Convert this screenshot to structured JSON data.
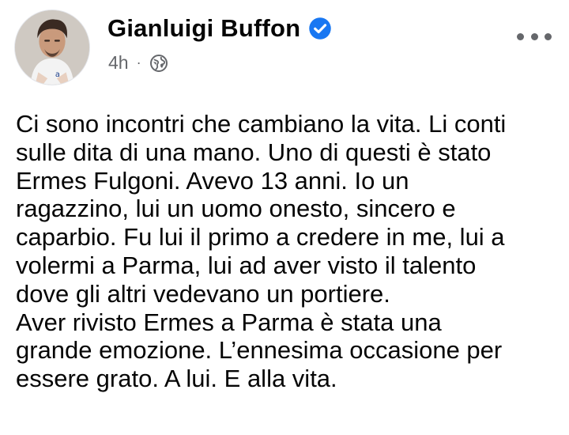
{
  "post": {
    "author": {
      "name": "Gianluigi Buffon",
      "verified": true,
      "avatar_icon": "profile-photo"
    },
    "timestamp": "4h",
    "separator": "·",
    "privacy_icon": "globe-icon",
    "more_icon": "more-options-icon",
    "text_lines": [
      "Ci sono incontri che cambiano la vita. Li conti",
      "sulle dita di una mano. Uno di questi è stato",
      "Ermes Fulgoni. Avevo 13 anni. Io un",
      "ragazzino, lui un uomo onesto, sincero e",
      "caparbio. Fu lui il primo a credere in me, lui a",
      "volermi a Parma, lui ad aver visto il talento",
      "dove gli altri vedevano un portiere.",
      "Aver rivisto Ermes a Parma è stata una",
      "grande emozione. L’ennesima occasione per",
      "essere grato. A lui. E alla vita."
    ]
  },
  "colors": {
    "verified_badge": "#1877f2",
    "secondary_text": "#65676b",
    "primary_text": "#050505"
  }
}
